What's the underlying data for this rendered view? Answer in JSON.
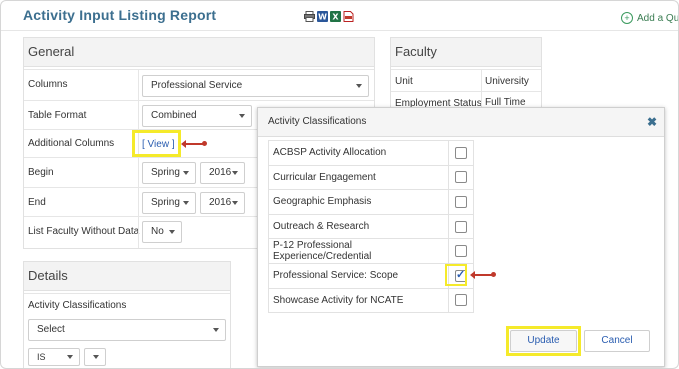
{
  "header": {
    "title": "Activity Input Listing Report",
    "add_link": "Add a Qu",
    "toolbar_icons": [
      "printer-icon",
      "word-icon",
      "excel-icon",
      "pdf-icon"
    ]
  },
  "general": {
    "heading": "General",
    "columns_label": "Columns",
    "columns_value": "Professional Service",
    "table_format_label": "Table Format",
    "table_format_value": "Combined",
    "additional_columns_label": "Additional Columns",
    "view_link": "[ View ]",
    "begin_label": "Begin",
    "begin_term": "Spring",
    "begin_year": "2016",
    "end_label": "End",
    "end_term": "Spring",
    "end_year": "2016",
    "list_faculty_label": "List Faculty Without Data",
    "list_faculty_value": "No"
  },
  "faculty": {
    "heading": "Faculty",
    "unit_label": "Unit",
    "unit_value": "University",
    "employment_label": "Employment Status",
    "employment_value": "Full Time"
  },
  "details": {
    "heading": "Details",
    "activity_label": "Activity Classifications",
    "select_placeholder": "Select",
    "operator_value": "IS"
  },
  "modal": {
    "title": "Activity Classifications",
    "close_glyph": "✖",
    "items": [
      {
        "label": "ACBSP Activity Allocation",
        "checked": false
      },
      {
        "label": "Curricular Engagement",
        "checked": false
      },
      {
        "label": "Geographic Emphasis",
        "checked": false
      },
      {
        "label": "Outreach & Research",
        "checked": false
      },
      {
        "label": "P-12 Professional Experience/Credential",
        "checked": false
      },
      {
        "label": "Professional Service: Scope",
        "checked": true
      },
      {
        "label": "Showcase Activity for NCATE",
        "checked": false
      }
    ],
    "update_label": "Update",
    "cancel_label": "Cancel"
  },
  "colors": {
    "title_blue": "#3c6f8f",
    "highlight_yellow": "#f5ea2a",
    "annotation_red": "#c0392b",
    "link_blue": "#2a5db0"
  }
}
